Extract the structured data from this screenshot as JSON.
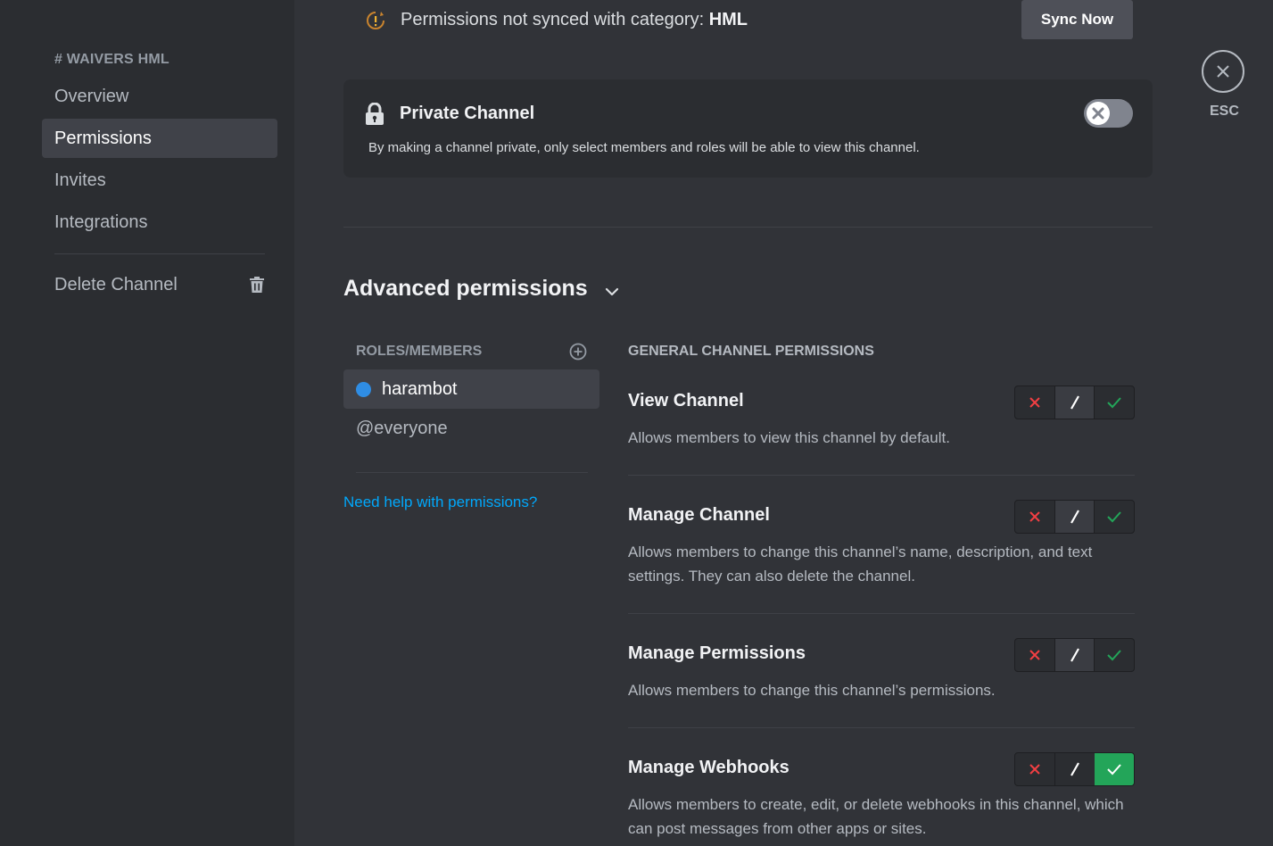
{
  "sidebar": {
    "header": "# WAIVERS HML",
    "items": [
      {
        "label": "Overview"
      },
      {
        "label": "Permissions"
      },
      {
        "label": "Invites"
      },
      {
        "label": "Integrations"
      }
    ],
    "delete_label": "Delete Channel",
    "selected": "Permissions"
  },
  "sync": {
    "text_prefix": "Permissions not synced with category: ",
    "category": "HML",
    "button_label": "Sync Now"
  },
  "private_channel": {
    "title": "Private Channel",
    "description": "By making a channel private, only select members and roles will be able to view this channel.",
    "enabled": false
  },
  "advanced": {
    "title": "Advanced permissions"
  },
  "roles": {
    "header": "ROLES/MEMBERS",
    "items": [
      {
        "label": "harambot",
        "dot_color": "#2f8de4"
      },
      {
        "label": "@everyone"
      }
    ],
    "help_link": "Need help with permissions?"
  },
  "permissions": {
    "header": "GENERAL CHANNEL PERMISSIONS",
    "items": [
      {
        "name": "View Channel",
        "description": "Allows members to view this channel by default.",
        "state": "neutral"
      },
      {
        "name": "Manage Channel",
        "description": "Allows members to change this channel’s name, description, and text settings. They can also delete the channel.",
        "state": "neutral"
      },
      {
        "name": "Manage Permissions",
        "description": "Allows members to change this channel’s permissions.",
        "state": "neutral"
      },
      {
        "name": "Manage Webhooks",
        "description": "Allows members to create, edit, or delete webhooks in this channel, which can post messages from other apps or sites.",
        "state": "allow"
      }
    ]
  },
  "close": {
    "label": "ESC"
  },
  "colors": {
    "deny": "#f23f43",
    "allow": "#23a559",
    "link": "#00a8fc"
  }
}
